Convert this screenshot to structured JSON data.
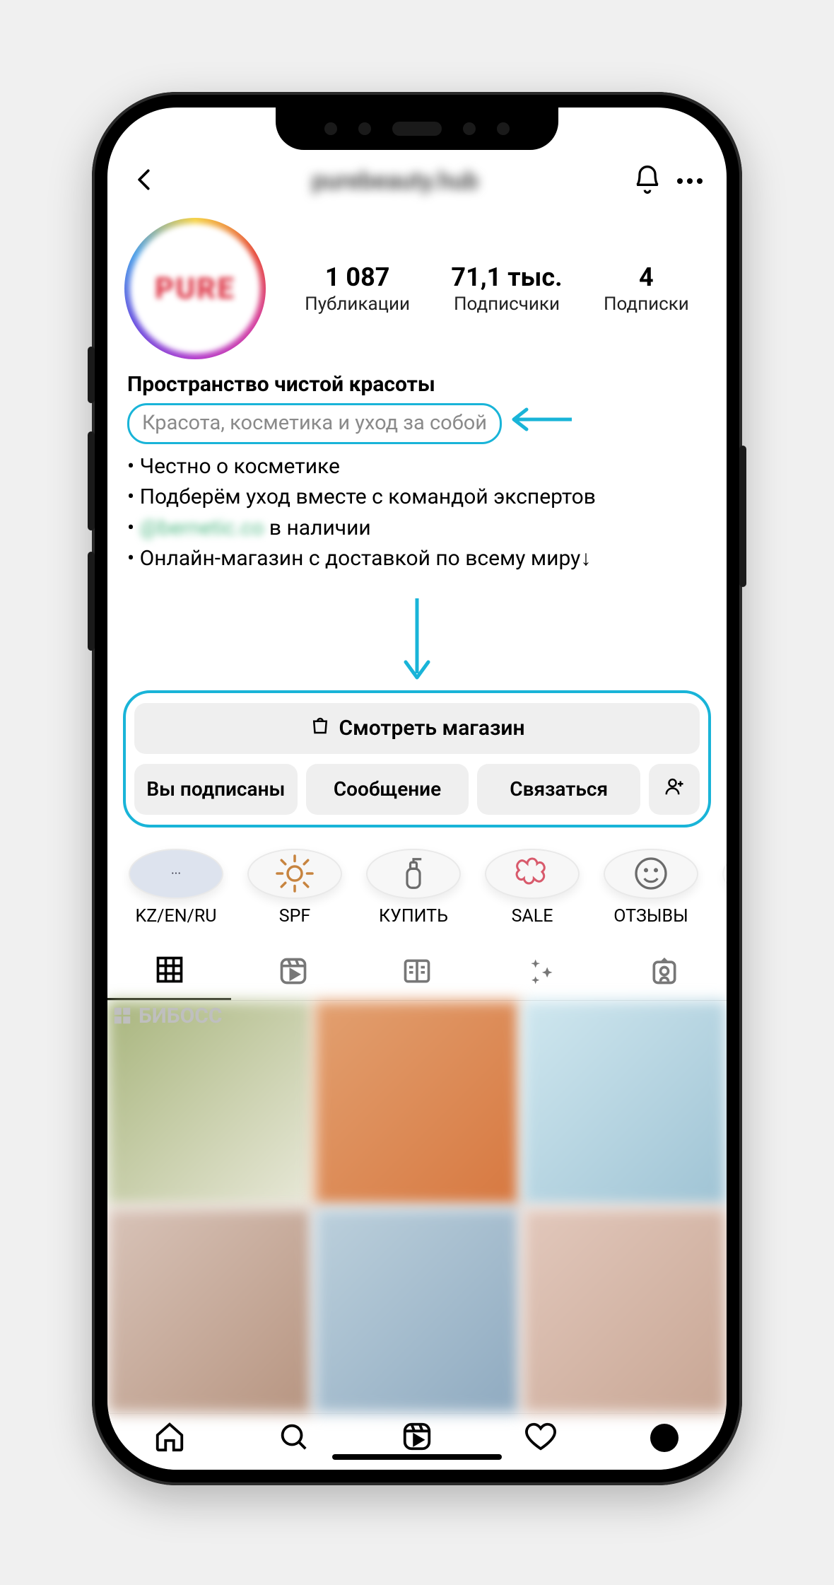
{
  "header": {
    "username": "purebeauty.hub"
  },
  "avatar": {
    "text": "PURE"
  },
  "stats": {
    "posts": {
      "value": "1 087",
      "label": "Публикации"
    },
    "followers": {
      "value": "71,1 тыс.",
      "label": "Подписчики"
    },
    "following": {
      "value": "4",
      "label": "Подписки"
    }
  },
  "bio": {
    "title": "Пространство чистой красоты",
    "category": "Красота, косметика и уход за собой",
    "lines": [
      "Честно о косметике",
      "Подберём уход вместе с командой экспертов",
      "",
      "Онлайн-магазин с доставкой по всему миру↓"
    ],
    "line3_prefix_blurred": "@bernetic.co",
    "line3_suffix": " в наличии"
  },
  "actions": {
    "shop": "Смотреть магазин",
    "following": "Вы подписаны",
    "message": "Сообщение",
    "contact": "Связаться"
  },
  "highlights": [
    {
      "label": "KZ/EN/RU",
      "icon": "doc"
    },
    {
      "label": "SPF",
      "icon": "sun"
    },
    {
      "label": "КУПИТЬ",
      "icon": "bottle"
    },
    {
      "label": "SALE",
      "icon": "flower"
    },
    {
      "label": "ОТЗЫВЫ",
      "icon": "smile"
    }
  ],
  "watermark": "БИБОСС",
  "colors": {
    "highlight_ring": "#19b4d8"
  }
}
